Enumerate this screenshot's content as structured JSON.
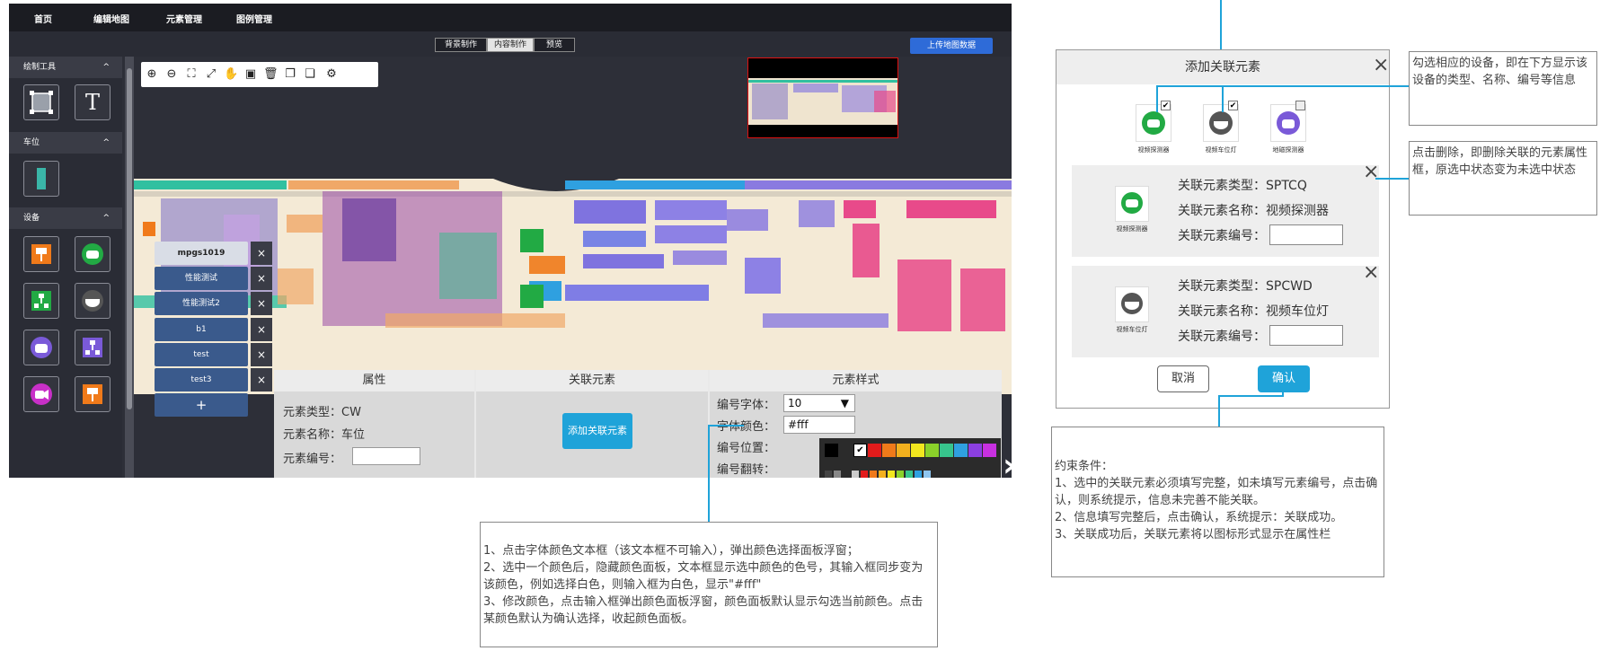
{
  "nav": {
    "items": [
      "首页",
      "编辑地图",
      "元素管理",
      "图例管理"
    ]
  },
  "subbar": {
    "modes": [
      "背景制作",
      "内容制作",
      "预览"
    ],
    "active_mode": "内容制作",
    "upload_label": "上传地图数据"
  },
  "sidebar": {
    "sections": [
      {
        "title": "绘制工具",
        "caret": "^"
      },
      {
        "title": "车位",
        "caret": "^"
      },
      {
        "title": "设备",
        "caret": "^"
      }
    ],
    "draw_text_tool": "T"
  },
  "layers": {
    "items": [
      "mpgs1019",
      "性能测试",
      "性能测试2",
      "b1",
      "test",
      "test3"
    ],
    "close_glyph": "×",
    "add_label": "+"
  },
  "properties": {
    "headers": [
      "属性",
      "关联元素",
      "元素样式"
    ],
    "element_type_label": "元素类型：CW",
    "element_name_label": "元素名称：车位",
    "element_number_label": "元素编号：",
    "add_related_button": "添加关联元素",
    "style": {
      "number_font_label": "编号字体：",
      "number_font_value": "10",
      "font_color_label": "字体颜色：",
      "font_color_value": "#fff",
      "number_position_label": "编号位置：",
      "number_flip_label": "编号翻转："
    }
  },
  "palette": {
    "top_colors": [
      "#000000",
      "#2b2b2b",
      "#ffffff",
      "#e21b1b",
      "#f07a1a",
      "#f2b01e",
      "#f2e71e",
      "#8ad12a",
      "#37c48c",
      "#2fa0e0",
      "#8b3fe0",
      "#c830e0"
    ],
    "selected_index": 2,
    "grid_rows": [
      [
        "#444444",
        "#888888",
        "#2b2b2b",
        "#cccccc",
        "#e21b1b",
        "#f07a1a",
        "#f2b01e",
        "#f2e71e",
        "#8ad12a",
        "#37c48c",
        "#2fa0e0",
        "#8ec5f0"
      ],
      [
        "#ee66cc",
        "#555555",
        "#999999",
        "#bbbbbb",
        "#c81818",
        "#e06a14",
        "#e0a018",
        "#e0d418",
        "#76b822",
        "#2ea676",
        "#2686c0",
        "#4aa8e0"
      ],
      [
        "#9b4ae0",
        "#333333",
        "#666666",
        "#aaaaaa",
        "#a01010",
        "#b8520e",
        "#b88012",
        "#b8ae12",
        "#5e941a",
        "#228060",
        "#1c6696",
        "#2a5ea8"
      ],
      [
        "#3a3ab0",
        "#5a2aa0",
        "#b02aa0"
      ]
    ]
  },
  "dialog": {
    "title": "添加关联元素",
    "close_glyph": "×",
    "devices": [
      {
        "label": "视频探测器",
        "checked": true,
        "color": "#22aa44"
      },
      {
        "label": "视频车位灯",
        "checked": true,
        "color": "#555555"
      },
      {
        "label": "地磁探测器",
        "checked": false,
        "color": "#7a5ad8"
      }
    ],
    "related": [
      {
        "type": "关联元素类型：SPTCQ",
        "name": "关联元素名称：视频探测器",
        "number": "关联元素编号：",
        "icon_label": "视频探测器",
        "color": "#22aa44"
      },
      {
        "type": "关联元素类型：SPCWD",
        "name": "关联元素名称：视频车位灯",
        "number": "关联元素编号：",
        "icon_label": "视频车位灯",
        "color": "#555555"
      }
    ],
    "cancel_label": "取消",
    "confirm_label": "确认"
  },
  "notes": {
    "check_device": "勾选相应的设备，即在下方显示该设备的类型、名称、编号等信息",
    "click_delete": "点击删除，即删除关联的元素属性框，原选中状态变为未选中状态",
    "constraints": [
      "约束条件：",
      "1、选中的关联元素必须填写完整，如未填写元素编号，点击确认，则系统提示，信息未完善不能关联。",
      "2、信息填写完整后，点击确认，系统提示：关联成功。",
      "3、关联成功后，关联元素将以图标形式显示在属性栏"
    ],
    "color_rules": [
      "1、点击字体颜色文本框（该文本框不可输入），弹出颜色选择面板浮窗；",
      "2、选中一个颜色后，隐藏颜色面板，文本框显示选中颜色的色号，其输入框同步变为该颜色，例如选择白色，则输入框为白色，显示\"#fff\"",
      "3、修改颜色，点击输入框弹出颜色面板浮窗，颜色面板默认显示勾选当前颜色。点击某颜色默认为确认选择，收起颜色面板。"
    ]
  },
  "colors": {
    "accent": "#1fa3d9",
    "upload": "#2e6bd8"
  }
}
